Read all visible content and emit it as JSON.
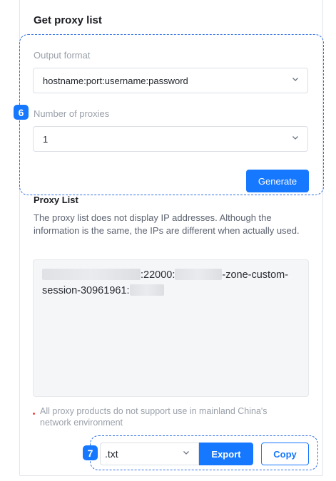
{
  "panel": {
    "title": "Get proxy list"
  },
  "form": {
    "output_format_label": "Output format",
    "output_format_value": "hostname:port:username:password",
    "proxies_label": "Number of proxies",
    "proxies_value": "1",
    "generate_label": "Generate"
  },
  "badges": {
    "form_step": "6",
    "export_step": "7"
  },
  "proxy_list": {
    "title": "Proxy List",
    "description": "The proxy list does not display IP addresses. Although the information is the same, the IPs are different when actually used.",
    "line_port": ":22000:",
    "line_zone": "-zone-custom-",
    "line_session": "session-30961961:"
  },
  "notice": {
    "text": "All proxy products do not support use in mainland China's network environment"
  },
  "export": {
    "format_value": ".txt",
    "export_label": "Export",
    "copy_label": "Copy"
  },
  "colors": {
    "accent": "#1677ff",
    "dash_highlight": "#2f6fe4",
    "notice_dot": "#f53f3f"
  }
}
